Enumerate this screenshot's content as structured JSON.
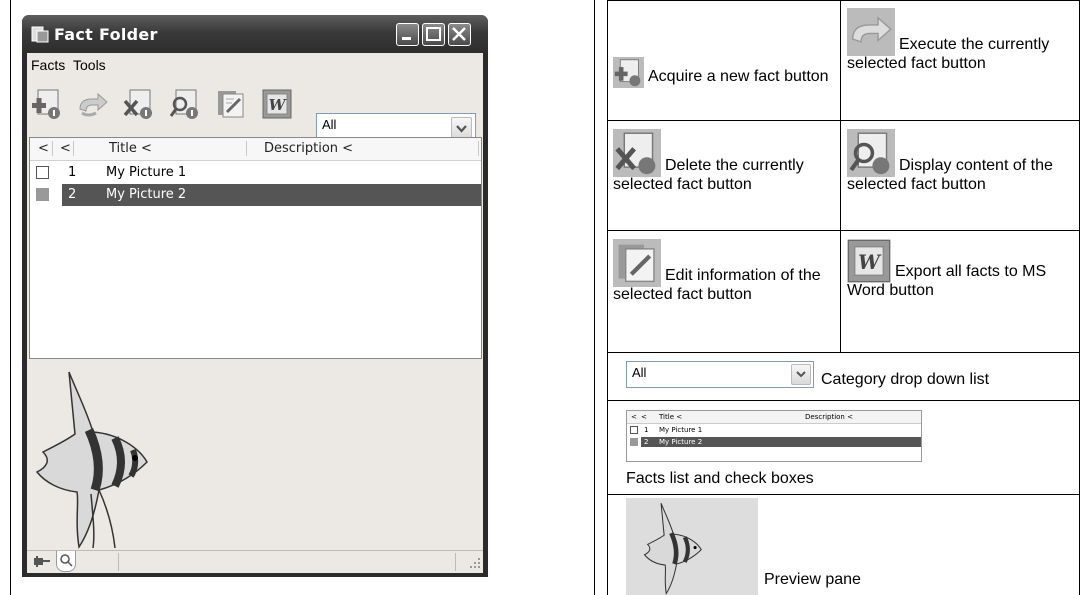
{
  "window": {
    "title": "Fact Folder",
    "menu": [
      "Facts",
      "Tools"
    ],
    "category_value": "All",
    "list": {
      "headers": [
        "<",
        "<",
        "Title <",
        "Description <"
      ],
      "rows": [
        {
          "num": "1",
          "title": "My Picture 1",
          "checked": false,
          "selected": false
        },
        {
          "num": "2",
          "title": "My Picture 2",
          "checked": true,
          "selected": true
        }
      ]
    },
    "toolbar_icons": [
      "acquire-fact-icon",
      "execute-fact-icon",
      "delete-fact-icon",
      "display-content-icon",
      "edit-info-icon",
      "export-word-icon"
    ]
  },
  "legend": {
    "acquire": "Acquire a new fact button",
    "execute": "Execute the currently selected fact button",
    "delete": "Delete the currently selected fact button",
    "display": "Display content of the selected fact button",
    "edit": "Edit information of the selected fact button",
    "export": "Export all facts to MS Word button",
    "category_value": "All",
    "category": "Category drop down list",
    "facts_list": "Facts list and check boxes",
    "preview": "Preview pane"
  },
  "colors": {
    "titlebar": "#3a3a3a",
    "window_bg": "#ece9e4",
    "selection": "#555555"
  }
}
